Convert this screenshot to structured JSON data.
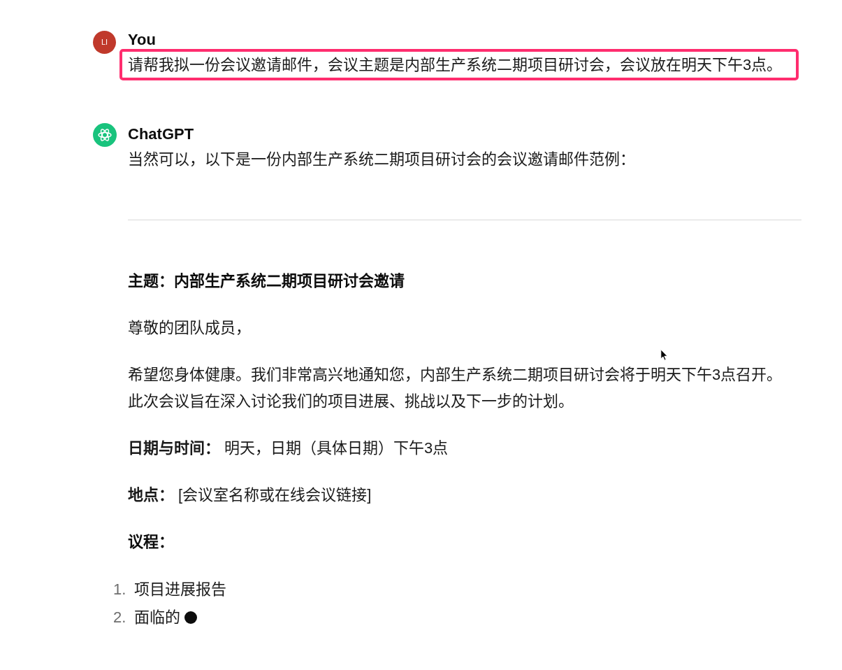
{
  "messages": [
    {
      "kind": "user",
      "author": "You",
      "avatar_initials": "LI",
      "color": "#c0392b",
      "highlighted": true,
      "text": "请帮我拟一份会议邀请邮件，会议主题是内部生产系统二期项目研讨会，会议放在明天下午3点。"
    },
    {
      "kind": "assistant",
      "author": "ChatGPT",
      "color": "#19c37d",
      "streaming": true,
      "intro": "当然可以，以下是一份内部生产系统二期项目研讨会的会议邀请邮件范例：",
      "blocks": [
        {
          "kind": "divider"
        },
        {
          "kind": "bold",
          "text": "主题：内部生产系统二期项目研讨会邀请"
        },
        {
          "kind": "paragraph",
          "text": "尊敬的团队成员，"
        },
        {
          "kind": "paragraph",
          "text": "希望您身体健康。我们非常高兴地通知您，内部生产系统二期项目研讨会将于明天下午3点召开。此次会议旨在深入讨论我们的项目进展、挑战以及下一步的计划。"
        },
        {
          "kind": "paragraph",
          "text": "**日期与时间：** 明天，日期（具体日期）下午3点"
        },
        {
          "kind": "paragraph",
          "text": "**地点：** [会议室名称或在线会议链接]"
        },
        {
          "kind": "bold",
          "text": "议程："
        },
        {
          "kind": "ordered_list",
          "items": [
            {
              "number": "1.",
              "text": "项目进展报告"
            },
            {
              "number": "2.",
              "text": "面临的"
            }
          ]
        }
      ]
    }
  ]
}
